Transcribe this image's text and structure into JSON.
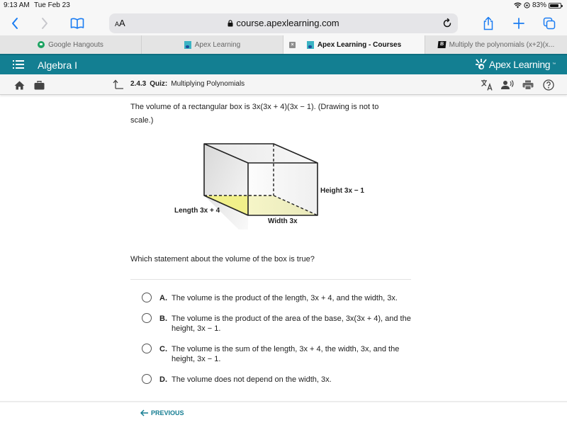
{
  "status_bar": {
    "time": "9:13 AM",
    "date": "Tue Feb 23",
    "battery_text": "83%",
    "battery_level": 0.83
  },
  "browser": {
    "text_size_label": "AA",
    "url": "course.apexlearning.com",
    "icons": {
      "back": "chevron-left-icon",
      "forward": "chevron-right-icon",
      "bookmarks": "book-icon",
      "lock": "lock-icon",
      "reload": "reload-icon",
      "share": "share-icon",
      "new_tab": "plus-icon",
      "tabs": "tabs-icon"
    },
    "tabs": [
      {
        "label": "Google Hangouts",
        "icon": "hangouts-icon",
        "active": false
      },
      {
        "label": "Apex Learning",
        "icon": "apex-icon",
        "active": false
      },
      {
        "label": "Apex Learning - Courses",
        "icon": "apex-icon",
        "active": true
      },
      {
        "label": "Multiply the polynomials (x+2)(x...",
        "icon": "brainly-icon",
        "active": false
      }
    ]
  },
  "app": {
    "course_title": "Algebra I",
    "brand": "Apex Learning",
    "brand_color": "#137f92",
    "breadcrumb": {
      "number": "2.4.3",
      "type": "Quiz:",
      "title": "Multiplying Polynomials"
    }
  },
  "question": {
    "stem_line1": "The volume of a rectangular box is 3x(3x + 4)(3x − 1). (Drawing is not to",
    "stem_line2": "scale.)",
    "figure": {
      "height_label": "Height 3x − 1",
      "length_label": "Length 3x + 4",
      "width_label": "Width 3x",
      "base_color": "#f1f08a"
    },
    "prompt": "Which statement about the volume of the box is true?",
    "options": [
      {
        "letter": "A.",
        "text": "The volume is the product of the length, 3x + 4, and the width, 3x."
      },
      {
        "letter": "B.",
        "text": "The volume is the product of the area of the base, 3x(3x + 4), and the height, 3x − 1."
      },
      {
        "letter": "C.",
        "text": "The volume is the sum of the length, 3x + 4, the width, 3x, and the height, 3x − 1."
      },
      {
        "letter": "D.",
        "text": "The volume does not depend on the width, 3x."
      }
    ]
  },
  "footer": {
    "previous_label": "PREVIOUS"
  }
}
